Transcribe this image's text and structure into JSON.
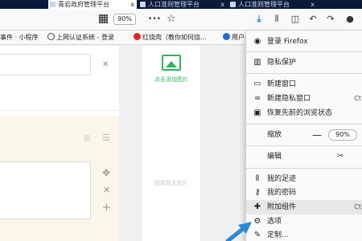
{
  "tabs": [
    {
      "label": "青岩政府管理平台",
      "close": "x"
    },
    {
      "label": "人口准则管理平台",
      "close": "x"
    },
    {
      "label": "人口准则管理平台",
      "close": "x"
    }
  ],
  "navbar": {
    "zoom": "90%",
    "more": "•••",
    "star": "☆",
    "icons": [
      "download-icon",
      "library-icon",
      "sidebar-icon",
      "back-history-icon",
      "redo-icon",
      "chat-icon"
    ]
  },
  "bookmarks": [
    {
      "label": "事件 · 小程序"
    },
    {
      "label": "上网认证系统 - 登录"
    },
    {
      "label": "红烧肉（教你如何烧..."
    },
    {
      "label": "用户"
    }
  ],
  "page": {
    "add_photo_label": "点击添加图片",
    "no_image_label": "图库暂无图片"
  },
  "menu": {
    "items": [
      {
        "label": "登录 Firefox",
        "icon": "account-icon"
      },
      {
        "label": "隐私保护",
        "icon": "privacy-chart-icon"
      },
      {
        "label": "新建窗口",
        "icon": "new-window-icon"
      },
      {
        "label": "新建隐私窗口",
        "icon": "mask-icon",
        "shortcut": "Ct"
      },
      {
        "label": "恢复先前的浏览状态",
        "icon": "restore-icon"
      },
      {
        "label": "缩放",
        "value": "90%"
      },
      {
        "label": "编辑"
      },
      {
        "label": "我的足迹",
        "icon": "library-icon"
      },
      {
        "label": "我的密码",
        "icon": "key-icon"
      },
      {
        "label": "附加组件",
        "icon": "puzzle-icon",
        "shortcut": "Ct"
      },
      {
        "label": "选项",
        "icon": "gear-icon"
      },
      {
        "label": "定制...",
        "icon": "brush-icon"
      }
    ]
  }
}
